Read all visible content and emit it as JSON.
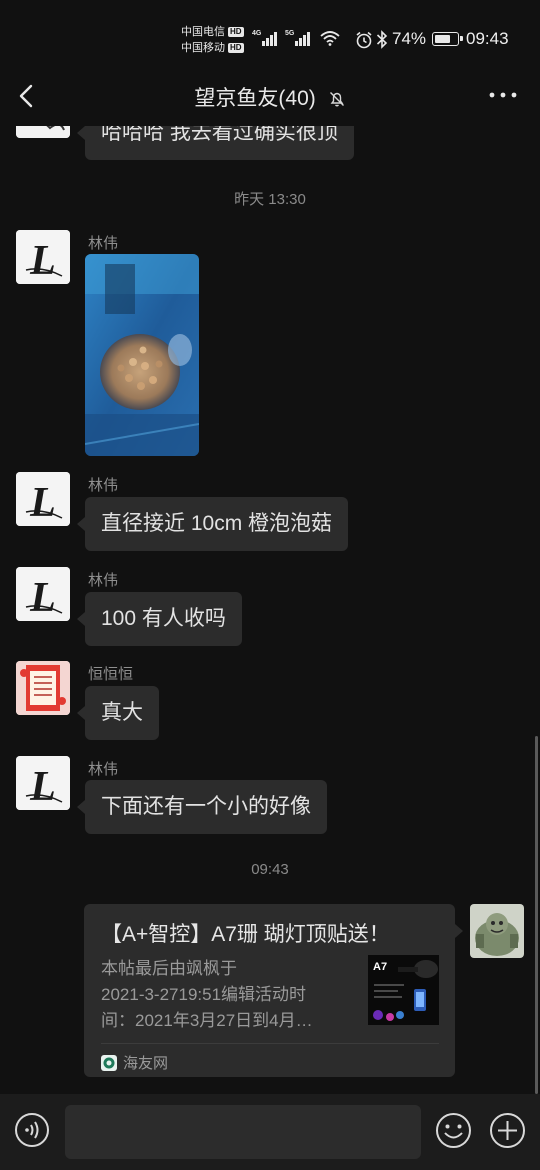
{
  "status_bar": {
    "carrier_1": "中国电信",
    "carrier_2": "中国移动",
    "hd_badge": "HD",
    "network_1": "4G",
    "network_2": "5G",
    "battery": "74%",
    "battery_level": 0.74,
    "time": "09:43",
    "icons": [
      "signal-icon",
      "wifi-icon",
      "alarm-icon",
      "bluetooth-icon",
      "battery-icon"
    ]
  },
  "header": {
    "title": "望京鱼友(40)",
    "icons": [
      "back-arrow-icon",
      "mute-bell-icon",
      "more-icon"
    ]
  },
  "messages": {
    "partial_text": "哈哈哈 我去看过确实很顶",
    "ts_1": "昨天 13:30",
    "m1_sender": "林伟",
    "m2_sender": "林伟",
    "m2_text": "直径接近 10cm 橙泡泡菇",
    "m3_sender": "林伟",
    "m3_text": "100 有人收吗",
    "m4_sender": "恒恒恒",
    "m4_text": "真大",
    "m5_sender": "林伟",
    "m5_text": "下面还有一个小的好像",
    "ts_2": "09:43",
    "card": {
      "title": "【A+智控】A7珊 瑚灯顶贴送！",
      "desc_lines": [
        "本帖最后由飒枫于",
        "2021-3-2719:51编辑活动时",
        "间：2021年3月27日到4月…"
      ],
      "thumb_label": "A7",
      "source": "海友网"
    }
  },
  "input_bar": {
    "placeholder": "",
    "icons": [
      "voice-icon",
      "emoji-icon",
      "plus-icon"
    ]
  },
  "colors": {
    "background": "#111111",
    "bubble": "#2c2c2c",
    "text": "#e2e2e2",
    "muted": "#8f8f8f"
  }
}
